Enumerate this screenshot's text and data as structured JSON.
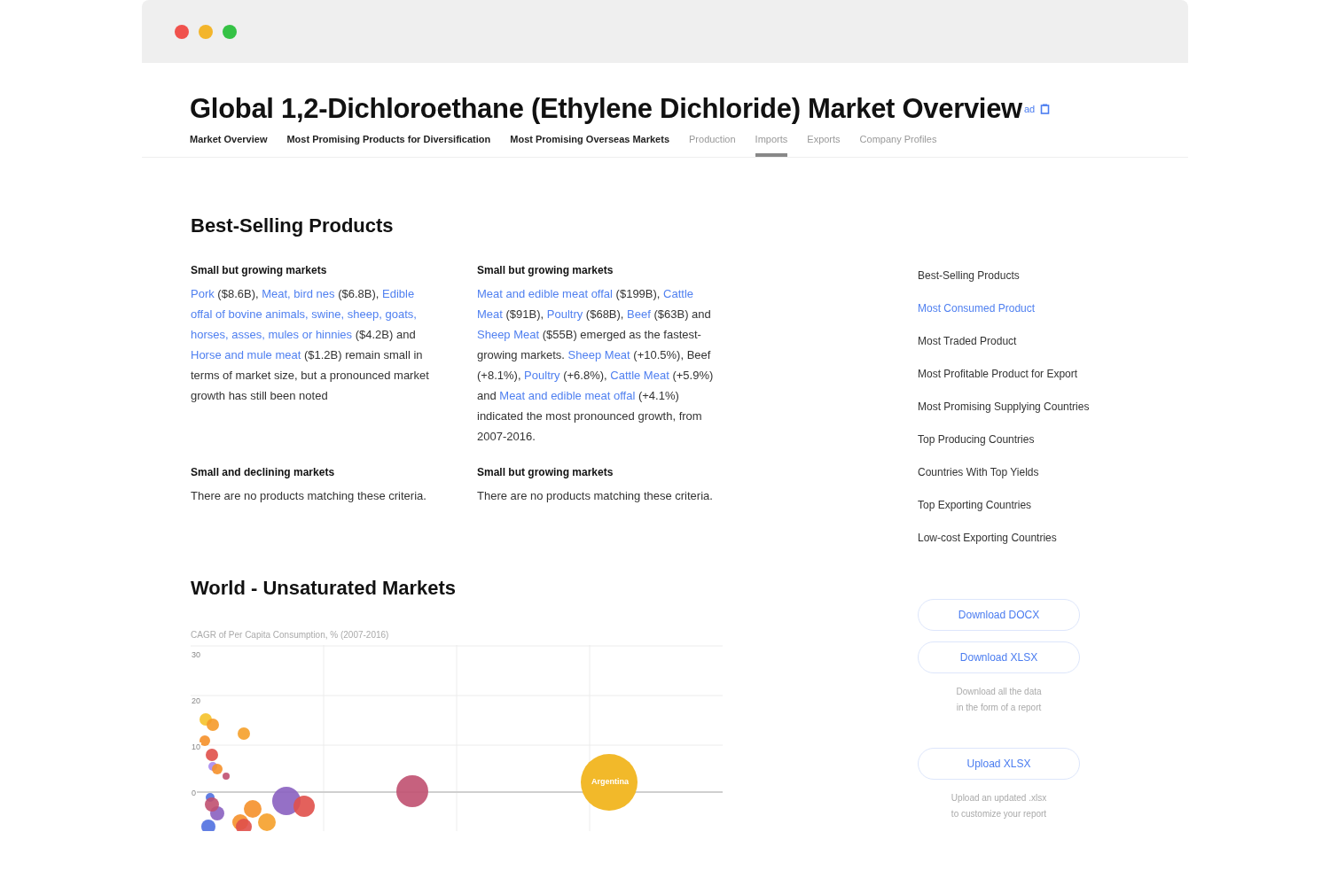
{
  "window": {
    "title": "Global 1,2-Dichloroethane (Ethylene Dichloride) Market Overview",
    "header_link": "ad"
  },
  "tabs": [
    {
      "label": "Market Overview",
      "selected": false,
      "kind": "main"
    },
    {
      "label": "Most Promising Products for Diversification",
      "selected": false,
      "kind": "main"
    },
    {
      "label": "Most Promising Overseas Markets",
      "selected": false,
      "kind": "main"
    },
    {
      "label": "Production",
      "selected": false,
      "kind": "sub"
    },
    {
      "label": "Imports",
      "selected": true,
      "kind": "sub"
    },
    {
      "label": "Exports",
      "selected": false,
      "kind": "sub"
    },
    {
      "label": "Company Profiles",
      "selected": false,
      "kind": "sub"
    }
  ],
  "section": {
    "heading": "Best-Selling Products",
    "blocks": [
      {
        "heading": "Small but growing markets",
        "segments": [
          {
            "text": "Pork",
            "link": true
          },
          {
            "text": " ($8.6B), ",
            "link": false
          },
          {
            "text": "Meat, bird nes",
            "link": true
          },
          {
            "text": " ($6.8B), ",
            "link": false
          },
          {
            "text": "Edible offal of bovine animals, swine, sheep, goats, horses, asses, mules or hinnies",
            "link": true
          },
          {
            "text": " ($4.2B) and ",
            "link": false
          },
          {
            "text": "Horse and mule meat",
            "link": true
          },
          {
            "text": " ($1.2B) remain small in terms of market size, but a pronounced market growth has still been noted",
            "link": false
          }
        ]
      },
      {
        "heading": "Small but growing markets",
        "segments": [
          {
            "text": "Meat and edible meat offal",
            "link": true
          },
          {
            "text": " ($199B), ",
            "link": false
          },
          {
            "text": "Cattle Meat",
            "link": true
          },
          {
            "text": " ($91B), ",
            "link": false
          },
          {
            "text": "Poultry",
            "link": true
          },
          {
            "text": " ($68B), ",
            "link": false
          },
          {
            "text": "Beef",
            "link": true
          },
          {
            "text": " ($63B) and ",
            "link": false
          },
          {
            "text": "Sheep Meat",
            "link": true
          },
          {
            "text": " ($55B) emerged as the fastest-growing markets. ",
            "link": false
          },
          {
            "text": "Sheep Meat",
            "link": true
          },
          {
            "text": " (+10.5%), Beef (+8.1%), ",
            "link": false
          },
          {
            "text": "Poultry",
            "link": true
          },
          {
            "text": " (+6.8%), ",
            "link": false
          },
          {
            "text": "Cattle Meat",
            "link": true
          },
          {
            "text": " (+5.9%) and ",
            "link": false
          },
          {
            "text": "Meat and edible meat offal",
            "link": true
          },
          {
            "text": " (+4.1%) indicated the most pronounced growth, from 2007-2016.",
            "link": false
          }
        ]
      },
      {
        "heading": "Small and declining markets",
        "segments": [
          {
            "text": "There are no products matching these criteria.",
            "link": false
          }
        ]
      },
      {
        "heading": "Small but growing markets",
        "segments": [
          {
            "text": "There are no products matching these criteria.",
            "link": false
          }
        ]
      }
    ]
  },
  "chart_section": {
    "heading": "World - Unsaturated Markets",
    "chart_title": "CAGR of Per Capita Consumption, % (2007-2016)",
    "y_tick_labels": [
      "30",
      "20",
      "10",
      "0"
    ],
    "bubble_label": "Argentina"
  },
  "sidebar": {
    "items": [
      {
        "label": "Best-Selling Products",
        "selected": false
      },
      {
        "label": "Most Consumed Product",
        "selected": true
      },
      {
        "label": "Most Traded Product",
        "selected": false
      },
      {
        "label": "Most Profitable Product for Export",
        "selected": false
      },
      {
        "label": "Most Promising Supplying Countries",
        "selected": false
      },
      {
        "label": "Top Producing Countries",
        "selected": false
      },
      {
        "label": "Countries With Top Yields",
        "selected": false
      },
      {
        "label": "Top Exporting Countries",
        "selected": false
      },
      {
        "label": "Low-cost Exporting Countries",
        "selected": false
      }
    ],
    "actions": [
      {
        "kind": "button",
        "label": "Download DOCX"
      },
      {
        "kind": "button",
        "label": "Download XLSX"
      },
      {
        "kind": "note",
        "lines": [
          "Download all the data",
          "in the form of a report"
        ]
      },
      {
        "kind": "button",
        "label": "Upload XLSX"
      },
      {
        "kind": "note",
        "lines": [
          "Upload an updated .xlsx",
          "to customize your report"
        ]
      }
    ]
  }
}
